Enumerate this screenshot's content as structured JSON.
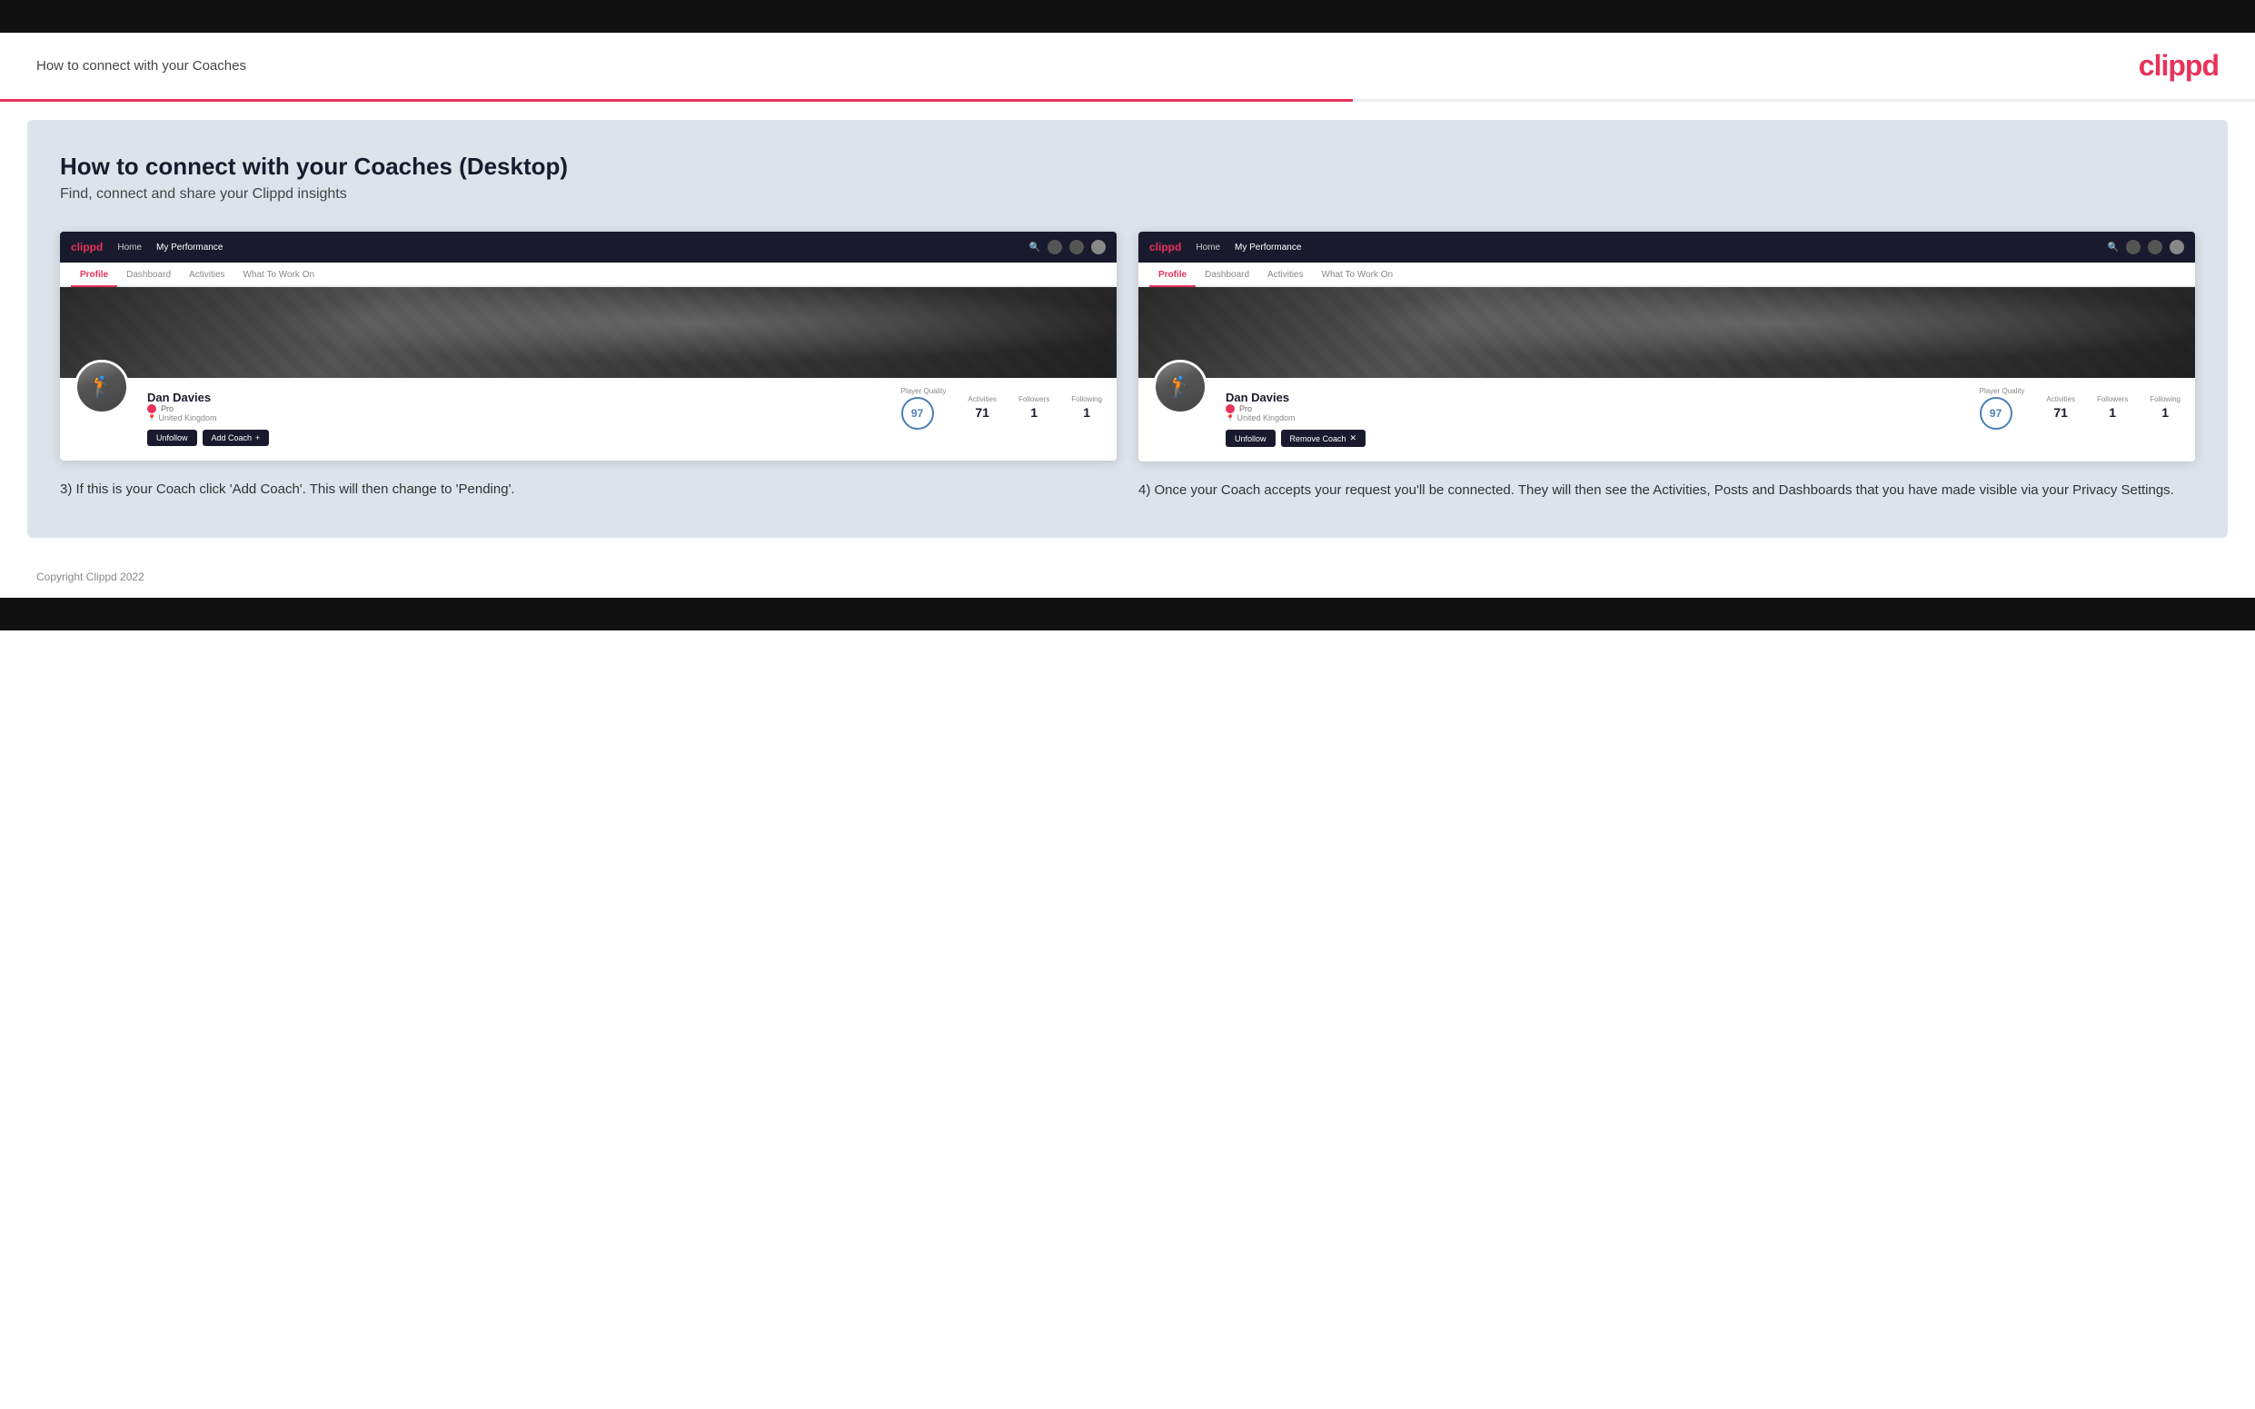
{
  "header": {
    "title": "How to connect with your Coaches",
    "logo": "clippd"
  },
  "main": {
    "heading": "How to connect with your Coaches (Desktop)",
    "subheading": "Find, connect and share your Clippd insights",
    "left_column": {
      "mock_nav": {
        "logo": "clippd",
        "links": [
          "Home",
          "My Performance"
        ]
      },
      "mock_tabs": [
        "Profile",
        "Dashboard",
        "Activities",
        "What To Work On"
      ],
      "active_tab": "Profile",
      "user": {
        "name": "Dan Davies",
        "role": "Pro",
        "location": "United Kingdom",
        "player_quality": "97",
        "activities": "71",
        "followers": "1",
        "following": "1"
      },
      "buttons": {
        "unfollow": "Unfollow",
        "add_coach": "Add Coach"
      },
      "caption": "3) If this is your Coach click 'Add Coach'. This will then change to 'Pending'."
    },
    "right_column": {
      "mock_nav": {
        "logo": "clippd",
        "links": [
          "Home",
          "My Performance"
        ]
      },
      "mock_tabs": [
        "Profile",
        "Dashboard",
        "Activities",
        "What To Work On"
      ],
      "active_tab": "Profile",
      "user": {
        "name": "Dan Davies",
        "role": "Pro",
        "location": "United Kingdom",
        "player_quality": "97",
        "activities": "71",
        "followers": "1",
        "following": "1"
      },
      "buttons": {
        "unfollow": "Unfollow",
        "remove_coach": "Remove Coach"
      },
      "caption": "4) Once your Coach accepts your request you'll be connected. They will then see the Activities, Posts and Dashboards that you have made visible via your Privacy Settings."
    }
  },
  "footer": {
    "copyright": "Copyright Clippd 2022"
  },
  "stat_labels": {
    "player_quality": "Player Quality",
    "activities": "Activities",
    "followers": "Followers",
    "following": "Following"
  }
}
